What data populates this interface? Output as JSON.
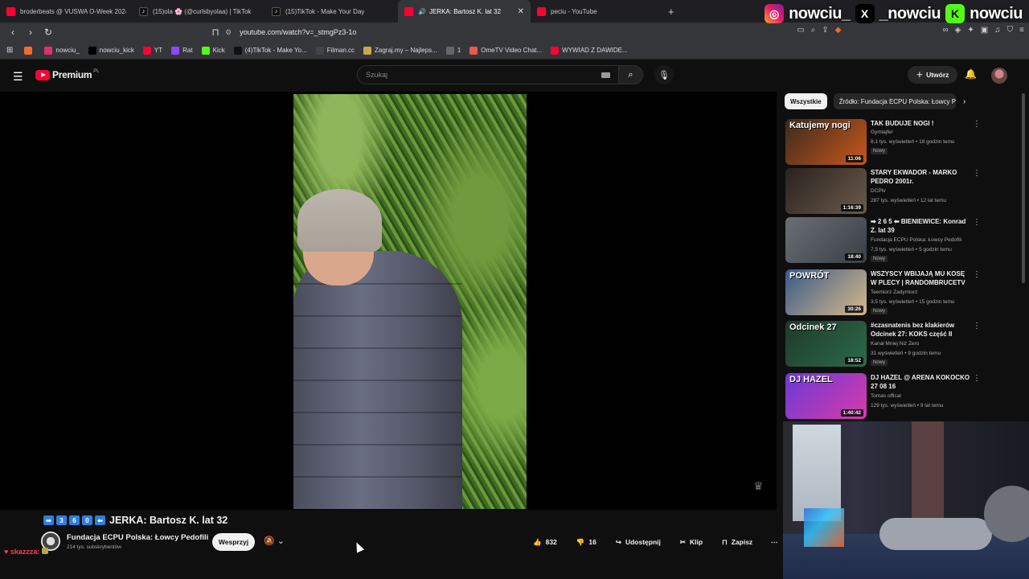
{
  "browser": {
    "tabs": [
      {
        "title": "broderbeats @ VUSWA O-Week 2024",
        "favicon": "youtube-icon"
      },
      {
        "title": "(15)ola 🌸 (@curlsbyolaa) | TikTok",
        "favicon": "tiktok-icon"
      },
      {
        "title": "(15)TikTok - Make Your Day",
        "favicon": "tiktok-icon"
      },
      {
        "title": "JERKA: Bartosz K. lat 32",
        "favicon": "youtube-icon",
        "active": true
      },
      {
        "title": "peciu - YouTube",
        "favicon": "youtube-icon"
      }
    ],
    "new_tab": "+",
    "url": "youtube.com/watch?v=_stmgPz3-1o",
    "bookmarks": [
      {
        "label": "",
        "icon": "brave-news-icon",
        "color": "#f26b2d"
      },
      {
        "label": "nowciu_",
        "icon": "instagram-icon",
        "color": "#e1306c"
      },
      {
        "label": "nowciu_kick",
        "icon": "x-icon",
        "color": "#000000"
      },
      {
        "label": "YT",
        "icon": "youtube-icon",
        "color": "#ff0033"
      },
      {
        "label": "Rat",
        "icon": "twitch-icon",
        "color": "#9146ff"
      },
      {
        "label": "Kick",
        "icon": "kick-icon",
        "color": "#53fc18"
      },
      {
        "label": "(4)TikTok - Make Yo...",
        "icon": "tiktok-icon",
        "color": "#111111"
      },
      {
        "label": "Filman.cc",
        "icon": "filman-icon",
        "color": "#444444"
      },
      {
        "label": "Zagraj.my – Najleps...",
        "icon": "zagraj-icon",
        "color": "#caa84a"
      },
      {
        "label": "1",
        "icon": "globe-icon",
        "color": "#666666"
      },
      {
        "label": "OmeTV Video Chat...",
        "icon": "ometv-icon",
        "color": "#e85a4f"
      },
      {
        "label": "WYWIAD Z DAWIDE...",
        "icon": "youtube-icon",
        "color": "#ff0033"
      }
    ]
  },
  "overlay": {
    "socials": [
      {
        "icon": "instagram-icon",
        "glyph": "◎",
        "handle": "nowciu_"
      },
      {
        "icon": "x-icon",
        "glyph": "X",
        "handle": "_nowciu"
      },
      {
        "icon": "kick-icon",
        "glyph": "K",
        "handle": "nowciu"
      }
    ]
  },
  "youtube": {
    "logo_text": "Premium",
    "logo_country": "PL",
    "search_placeholder": "Szukaj",
    "create_label": "Utwórz",
    "video": {
      "title_prefix_keys": [
        "➡",
        "3",
        "6",
        "0",
        "⬅"
      ],
      "title": "JERKA: Bartosz K. lat 32",
      "channel": "Fundacja ECPU Polska: Łowcy Pedofili",
      "subscribers": "214 tys. subskrybentów",
      "support_label": "Wesprzyj",
      "likes": "832",
      "dislikes": "16",
      "share_label": "Udostępnij",
      "clip_label": "Klip",
      "save_label": "Zapisz"
    },
    "chat": {
      "user": "skazzza",
      "text": ":"
    },
    "chips": [
      "Wszystkie",
      "Źródło: Fundacja ECPU Polska: Łowcy Pedofili"
    ],
    "recommendations": [
      {
        "title": "TAK BUDUJE NOGI !",
        "channel": "Gymlajfer",
        "meta": "8,1 tys. wyświetleń • 18 godzin temu",
        "badge": "Nowy",
        "duration": "11:06",
        "thumb_text": "Katujemy nogi",
        "thumb_colors": [
          "#3a2a1e",
          "#c9571b"
        ]
      },
      {
        "title": "STARY EKWADOR - MARKO PEDRO 2001r.",
        "channel": "DCPtv",
        "meta": "287 tys. wyświetleń • 12 lat temu",
        "badge": "",
        "duration": "1:16:39",
        "thumb_text": "",
        "thumb_colors": [
          "#2a2220",
          "#6a5a4a"
        ]
      },
      {
        "title": "➡ 2 6 5 ⬅ BIENIEWICE: Konrad Z. lat 39",
        "channel": "Fundacja ECPU Polska: Łowcy Pedofili",
        "meta": "7,5 tys. wyświetleń • 5 godzin temu",
        "badge": "Nowy",
        "duration": "18:40",
        "thumb_text": "",
        "thumb_colors": [
          "#6a6f76",
          "#3a3f44"
        ]
      },
      {
        "title": "WSZYSCY WBIJAJĄ MU KOSĘ W PLECY | RANDOMBRUCETV",
        "channel": "Teemiorz Zadymiorz",
        "meta": "3,5 tys. wyświetleń • 15 godzin temu",
        "badge": "Nowy",
        "duration": "30:26",
        "thumb_text": "POWRÓT",
        "thumb_colors": [
          "#3a5a8a",
          "#d8b88a"
        ]
      },
      {
        "title": "#czasnatenis bez klakierów Odcinek 27: KOKS część II",
        "channel": "Kanał Mniej Niż Zero",
        "meta": "31 wyświetleń • 9 godzin temu",
        "badge": "Nowy",
        "duration": "18:52",
        "thumb_text": "Odcinek 27",
        "thumb_colors": [
          "#1e3a2a",
          "#2c6a4a"
        ]
      },
      {
        "title": "DJ HAZEL @ ARENA KOKOCKO 27 08 16",
        "channel": "Tomas offical",
        "meta": "129 tys. wyświetleń • 9 lat temu",
        "badge": "",
        "duration": "1:40:42",
        "thumb_text": "DJ HAZEL",
        "thumb_colors": [
          "#6a3ad8",
          "#d83aa8"
        ]
      }
    ]
  }
}
